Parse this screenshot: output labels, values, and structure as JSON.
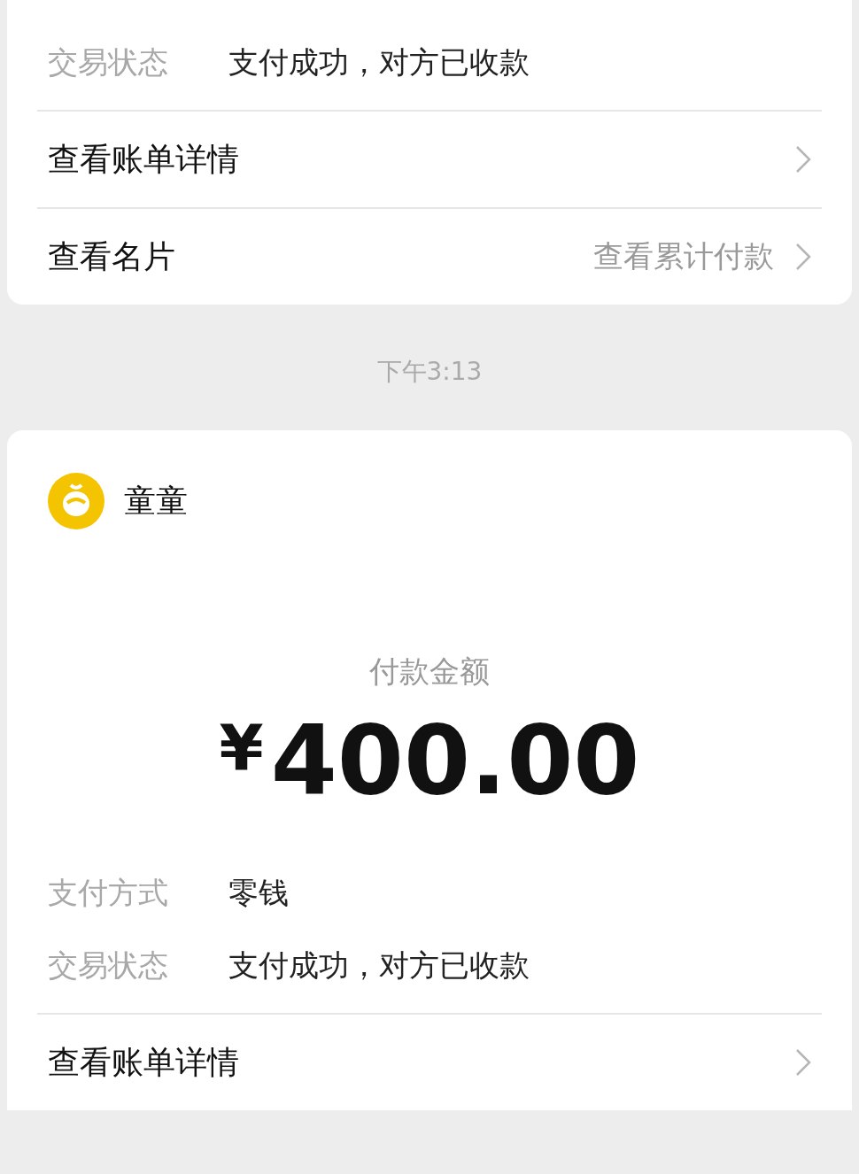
{
  "cards": [
    {
      "details": [
        {
          "label": "交易状态",
          "value": "支付成功，对方已收款"
        }
      ],
      "links": [
        {
          "label": "查看账单详情"
        },
        {
          "label": "查看名片",
          "hint": "查看累计付款"
        }
      ]
    },
    {
      "payee": "童童",
      "amount_label": "付款金额",
      "currency": "¥",
      "amount": "400.00",
      "details": [
        {
          "label": "支付方式",
          "value": "零钱"
        },
        {
          "label": "交易状态",
          "value": "支付成功，对方已收款"
        }
      ],
      "links": [
        {
          "label": "查看账单详情"
        }
      ]
    }
  ],
  "time_separator": "下午3:13"
}
